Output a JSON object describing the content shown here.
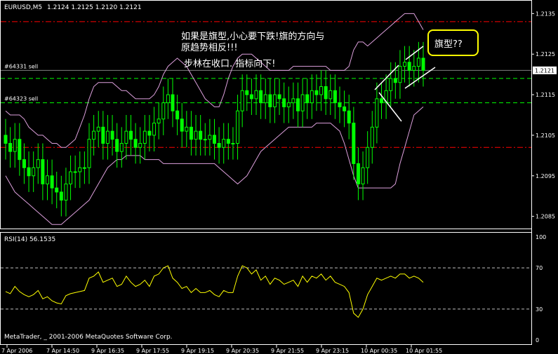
{
  "header": {
    "symbol": "EURUSD,M5",
    "ohlc": "1.2124 1.2125 1.2120 1.2121"
  },
  "main": {
    "price_ticks": [
      "1.2135",
      "1.2125",
      "1.2115",
      "1.2105",
      "1.2095",
      "1.2085"
    ],
    "price_tick_values": [
      1.2135,
      1.2125,
      1.2115,
      1.2105,
      1.2095,
      1.2085
    ],
    "current_price": "1.2121",
    "current_price_value": 1.2121,
    "orders": [
      {
        "label": "#64331 sell",
        "value": 1.2121
      },
      {
        "label": "#64323 sell",
        "value": 1.2113
      }
    ],
    "levels_red": [
      1.2133,
      1.2102
    ],
    "levels_green": [
      1.2119,
      1.2113
    ]
  },
  "annotations": {
    "line1": "如果是旗型,小心要下跌!旗的方向与",
    "line2": "原趋势相反!!!",
    "line3": "步林在收口. 指标向下!",
    "callout": "旗型??"
  },
  "rsi": {
    "title": "RSI(14) 56.1535",
    "ticks": [
      "100",
      "70",
      "30",
      "0"
    ],
    "tick_values": [
      100,
      70,
      30,
      0
    ],
    "levels": [
      70,
      30
    ]
  },
  "time_axis": [
    "7 Apr 2006",
    "7 Apr 14:50",
    "9 Apr 16:35",
    "9 Apr 17:55",
    "9 Apr 19:15",
    "9 Apr 20:35",
    "9 Apr 21:55",
    "9 Apr 23:15",
    "10 Apr 00:35",
    "10 Apr 01:55"
  ],
  "footer": "MetaTrader, _ 2001-2006 MetaQuotes Software Corp.",
  "colors": {
    "background": "#000000",
    "candle": "#00ff00",
    "bollinger": "#dda0dd",
    "level_red": "#ff0000",
    "level_green": "#00ff00",
    "rsi_line": "#ffff00",
    "text": "#ffffff",
    "callout_border": "#ffff00"
  },
  "chart_data": [
    {
      "type": "candlestick",
      "title": "EURUSD,M5",
      "ylim": [
        1.2082,
        1.2138
      ],
      "close": [
        1.2103,
        1.2101,
        1.2104,
        1.2099,
        1.2097,
        1.2095,
        1.2097,
        1.2099,
        1.2093,
        1.2095,
        1.2092,
        1.2091,
        1.2089,
        1.2093,
        1.2096,
        1.2096,
        1.2097,
        1.2097,
        1.2104,
        1.2106,
        1.2107,
        1.2103,
        1.2106,
        1.2104,
        1.2101,
        1.2103,
        1.2106,
        1.2104,
        1.2102,
        1.2103,
        1.2106,
        1.2105,
        1.2108,
        1.2109,
        1.2113,
        1.2115,
        1.2111,
        1.2109,
        1.2106,
        1.2107,
        1.2104,
        1.2106,
        1.2104,
        1.2104,
        1.2105,
        1.2103,
        1.2102,
        1.2104,
        1.2103,
        1.2103,
        1.2111,
        1.2116,
        1.2115,
        1.2114,
        1.2116,
        1.2113,
        1.2115,
        1.2112,
        1.2115,
        1.2114,
        1.2112,
        1.2113,
        1.2114,
        1.2111,
        1.2115,
        1.2113,
        1.2116,
        1.2115,
        1.2117,
        1.2114,
        1.2116,
        1.2113,
        1.2112,
        1.2111,
        1.2108,
        1.2098,
        1.2093,
        1.2097,
        1.2102,
        1.2107,
        1.2114,
        1.2113,
        1.2116,
        1.2119,
        1.2118,
        1.2122,
        1.2123,
        1.2121,
        1.2122,
        1.2124,
        1.2121
      ],
      "rsi": [
        47,
        45,
        52,
        47,
        44,
        42,
        44,
        48,
        40,
        42,
        38,
        36,
        35,
        43,
        45,
        46,
        47,
        48,
        60,
        62,
        66,
        56,
        58,
        60,
        52,
        54,
        62,
        56,
        52,
        54,
        58,
        52,
        62,
        64,
        70,
        72,
        60,
        56,
        50,
        52,
        46,
        50,
        46,
        46,
        48,
        44,
        42,
        48,
        46,
        46,
        62,
        72,
        70,
        64,
        68,
        58,
        62,
        54,
        60,
        58,
        54,
        56,
        58,
        52,
        62,
        56,
        62,
        60,
        64,
        58,
        62,
        56,
        54,
        52,
        46,
        26,
        22,
        30,
        44,
        52,
        60,
        58,
        60,
        62,
        60,
        64,
        64,
        60,
        62,
        60,
        56
      ],
      "bollinger_upper": [
        1.2111,
        1.211,
        1.211,
        1.211,
        1.2109,
        1.2107,
        1.2106,
        1.2105,
        1.2105,
        1.2104,
        1.2103,
        1.2103,
        1.2102,
        1.2102,
        1.2103,
        1.2104,
        1.2107,
        1.211,
        1.2114,
        1.2117,
        1.2118,
        1.2118,
        1.2118,
        1.2118,
        1.2117,
        1.2116,
        1.2116,
        1.2115,
        1.2114,
        1.2114,
        1.2114,
        1.2114,
        1.2115,
        1.2117,
        1.212,
        1.2122,
        1.2123,
        1.2124,
        1.2123,
        1.2122,
        1.212,
        1.2118,
        1.2116,
        1.2114,
        1.2113,
        1.2112,
        1.2112,
        1.2115,
        1.2119,
        1.2122,
        1.2124,
        1.2125,
        1.2125,
        1.2125,
        1.2124,
        1.2123,
        1.2122,
        1.2121,
        1.2121,
        1.2121,
        1.2121,
        1.2121,
        1.2122,
        1.2122,
        1.2122,
        1.2122,
        1.2122,
        1.2122,
        1.2122,
        1.2122,
        1.2121,
        1.2121,
        1.2121,
        1.2121,
        1.2122,
        1.2126,
        1.2128,
        1.2128,
        1.2127,
        1.2128,
        1.2129,
        1.213,
        1.2131,
        1.2132,
        1.2133,
        1.2134,
        1.2135,
        1.2135,
        1.2135,
        1.2133,
        1.2131
      ],
      "bollinger_lower": [
        1.2095,
        1.2093,
        1.2091,
        1.209,
        1.2089,
        1.2088,
        1.2087,
        1.2086,
        1.2085,
        1.2084,
        1.2083,
        1.2083,
        1.2083,
        1.2084,
        1.2085,
        1.2086,
        1.2087,
        1.2088,
        1.2089,
        1.2091,
        1.2093,
        1.2095,
        1.2097,
        1.2098,
        1.2099,
        1.2099,
        1.21,
        1.21,
        1.21,
        1.21,
        1.2099,
        1.2099,
        1.2099,
        1.2099,
        1.2098,
        1.2098,
        1.2098,
        1.2098,
        1.2098,
        1.2098,
        1.2098,
        1.2098,
        1.2098,
        1.2098,
        1.2098,
        1.2098,
        1.2097,
        1.2096,
        1.2095,
        1.2094,
        1.2093,
        1.2094,
        1.2095,
        1.2097,
        1.2099,
        1.2101,
        1.2102,
        1.2103,
        1.2104,
        1.2105,
        1.2106,
        1.2107,
        1.2107,
        1.2107,
        1.2107,
        1.2107,
        1.2107,
        1.2108,
        1.2108,
        1.2108,
        1.2108,
        1.2107,
        1.2106,
        1.2103,
        1.2099,
        1.2095,
        1.2092,
        1.2092,
        1.2092,
        1.2092,
        1.2092,
        1.2092,
        1.2092,
        1.2092,
        1.2093,
        1.2098,
        1.2102,
        1.2106,
        1.211,
        1.2111,
        1.2112
      ]
    }
  ]
}
